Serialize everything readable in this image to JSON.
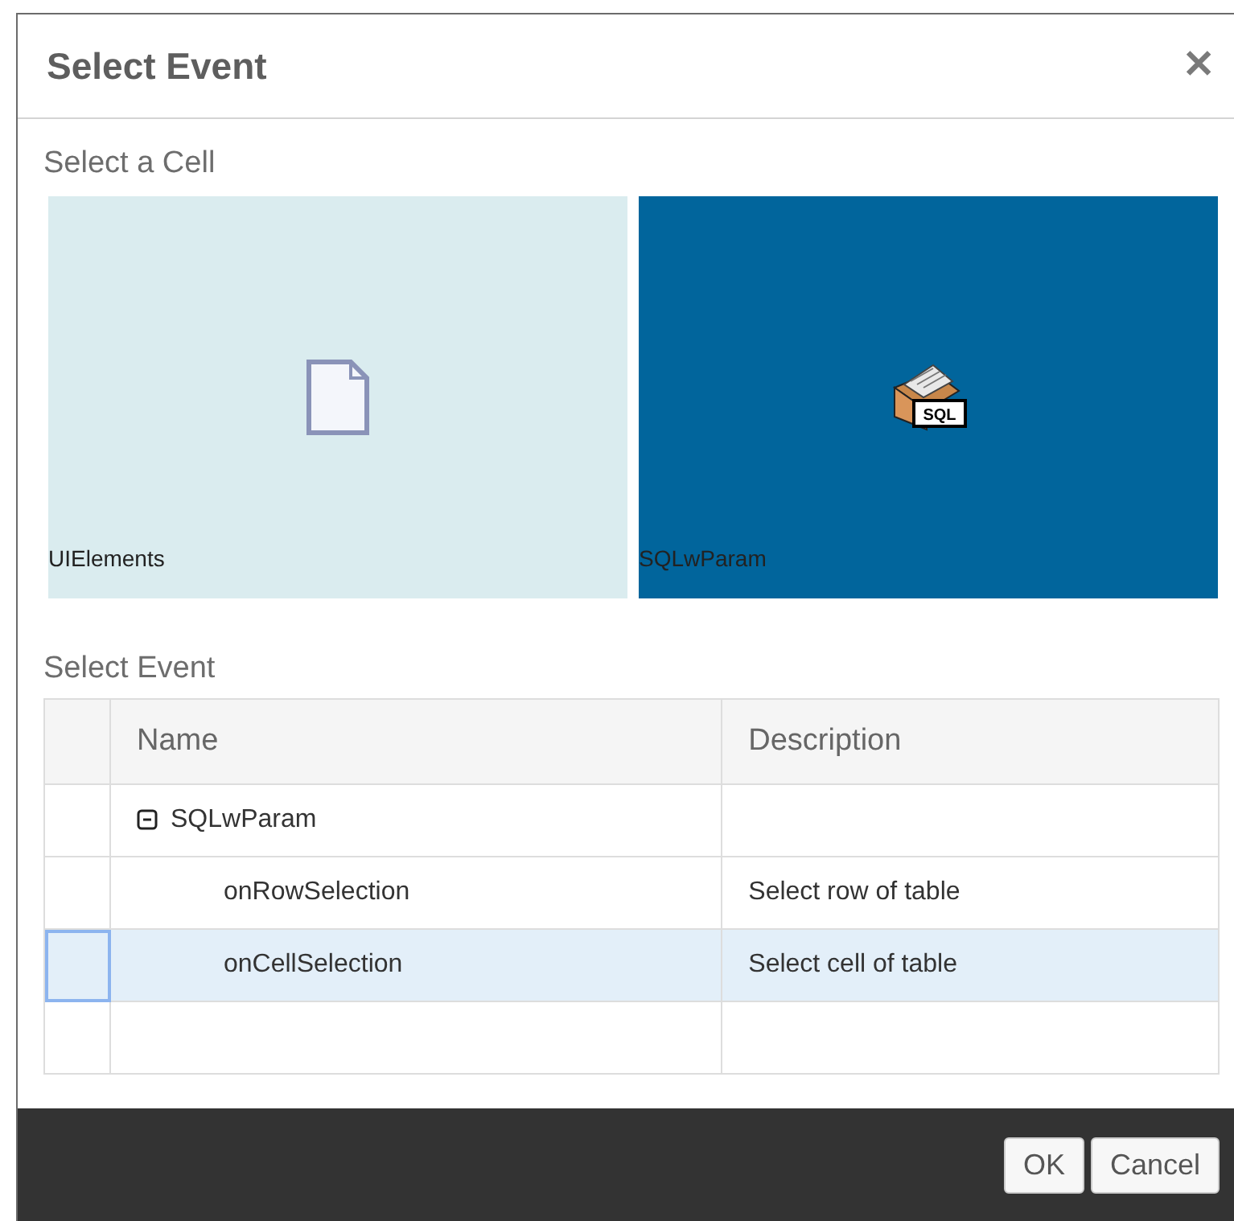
{
  "dialog": {
    "title": "Select Event",
    "close": "✕"
  },
  "cell_section": {
    "label": "Select a Cell",
    "cells": [
      {
        "name": "UIElements",
        "kind": "document",
        "selected": false
      },
      {
        "name": "SQLwParam",
        "kind": "sql",
        "icon_text": "SQL",
        "selected": true
      }
    ]
  },
  "event_section": {
    "label": "Select Event",
    "columns": [
      "Name",
      "Description"
    ],
    "rows": [
      {
        "name": "SQLwParam",
        "description": "",
        "expanded": true,
        "selected": false,
        "children": [
          {
            "name": "onRowSelection",
            "description": "Select row of table",
            "selected": false
          },
          {
            "name": "onCellSelection",
            "description": "Select cell of table",
            "selected": true
          }
        ]
      }
    ]
  },
  "buttons": [
    "OK",
    "Cancel"
  ]
}
